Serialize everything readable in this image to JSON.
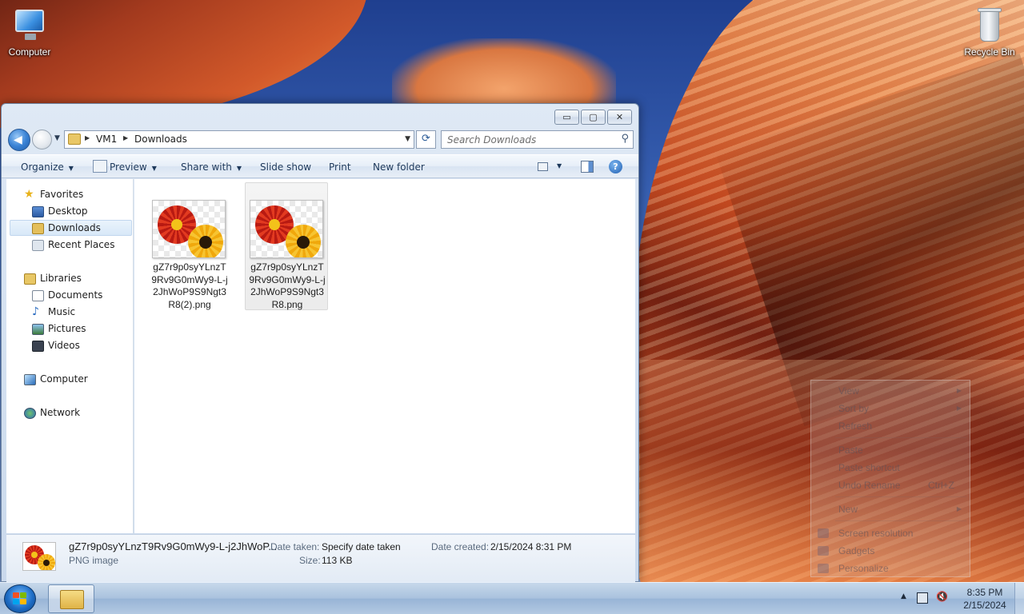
{
  "desktop": {
    "icons": [
      {
        "label": "Computer",
        "icon": "computer-icon"
      },
      {
        "label": "Recycle Bin",
        "icon": "recycle-bin-icon"
      }
    ]
  },
  "window": {
    "controls": {
      "minimize": "▭",
      "maximize": "▢",
      "close": "✕"
    },
    "address": {
      "crumbs": [
        "VM1",
        "Downloads"
      ]
    },
    "search": {
      "placeholder": "Search Downloads"
    },
    "toolbar": {
      "organize": "Organize",
      "preview": "Preview",
      "share_with": "Share with",
      "slide_show": "Slide show",
      "print": "Print",
      "new_folder": "New folder"
    },
    "nav": {
      "favorites": "Favorites",
      "desktop": "Desktop",
      "downloads": "Downloads",
      "recent_places": "Recent Places",
      "libraries": "Libraries",
      "documents": "Documents",
      "music": "Music",
      "pictures": "Pictures",
      "videos": "Videos",
      "computer": "Computer",
      "network": "Network"
    },
    "files": [
      {
        "name": "gZ7r9p0syYLnzT9Rv9G0mWy9-L-j2JhWoP9S9Ngt3R8(2).png"
      },
      {
        "name": "gZ7r9p0syYLnzT9Rv9G0mWy9-L-j2JhWoP9S9Ngt3R8.png"
      }
    ],
    "details": {
      "name": "gZ7r9p0syYLnzT9Rv9G0mWy9-L-j2JhWoP...",
      "type": "PNG image",
      "date_taken_label": "Date taken:",
      "date_taken_value": "Specify date taken",
      "size_label": "Size:",
      "size_value": "113 KB",
      "date_created_label": "Date created:",
      "date_created_value": "2/15/2024 8:31 PM"
    }
  },
  "context_menu": {
    "view": "View",
    "sort_by": "Sort by",
    "refresh": "Refresh",
    "paste": "Paste",
    "paste_shortcut": "Paste shortcut",
    "undo_rename": "Undo Rename",
    "undo_shortcut": "Ctrl+Z",
    "new": "New",
    "screen_resolution": "Screen resolution",
    "gadgets": "Gadgets",
    "personalize": "Personalize"
  },
  "taskbar": {
    "time": "8:35 PM",
    "date": "2/15/2024"
  }
}
